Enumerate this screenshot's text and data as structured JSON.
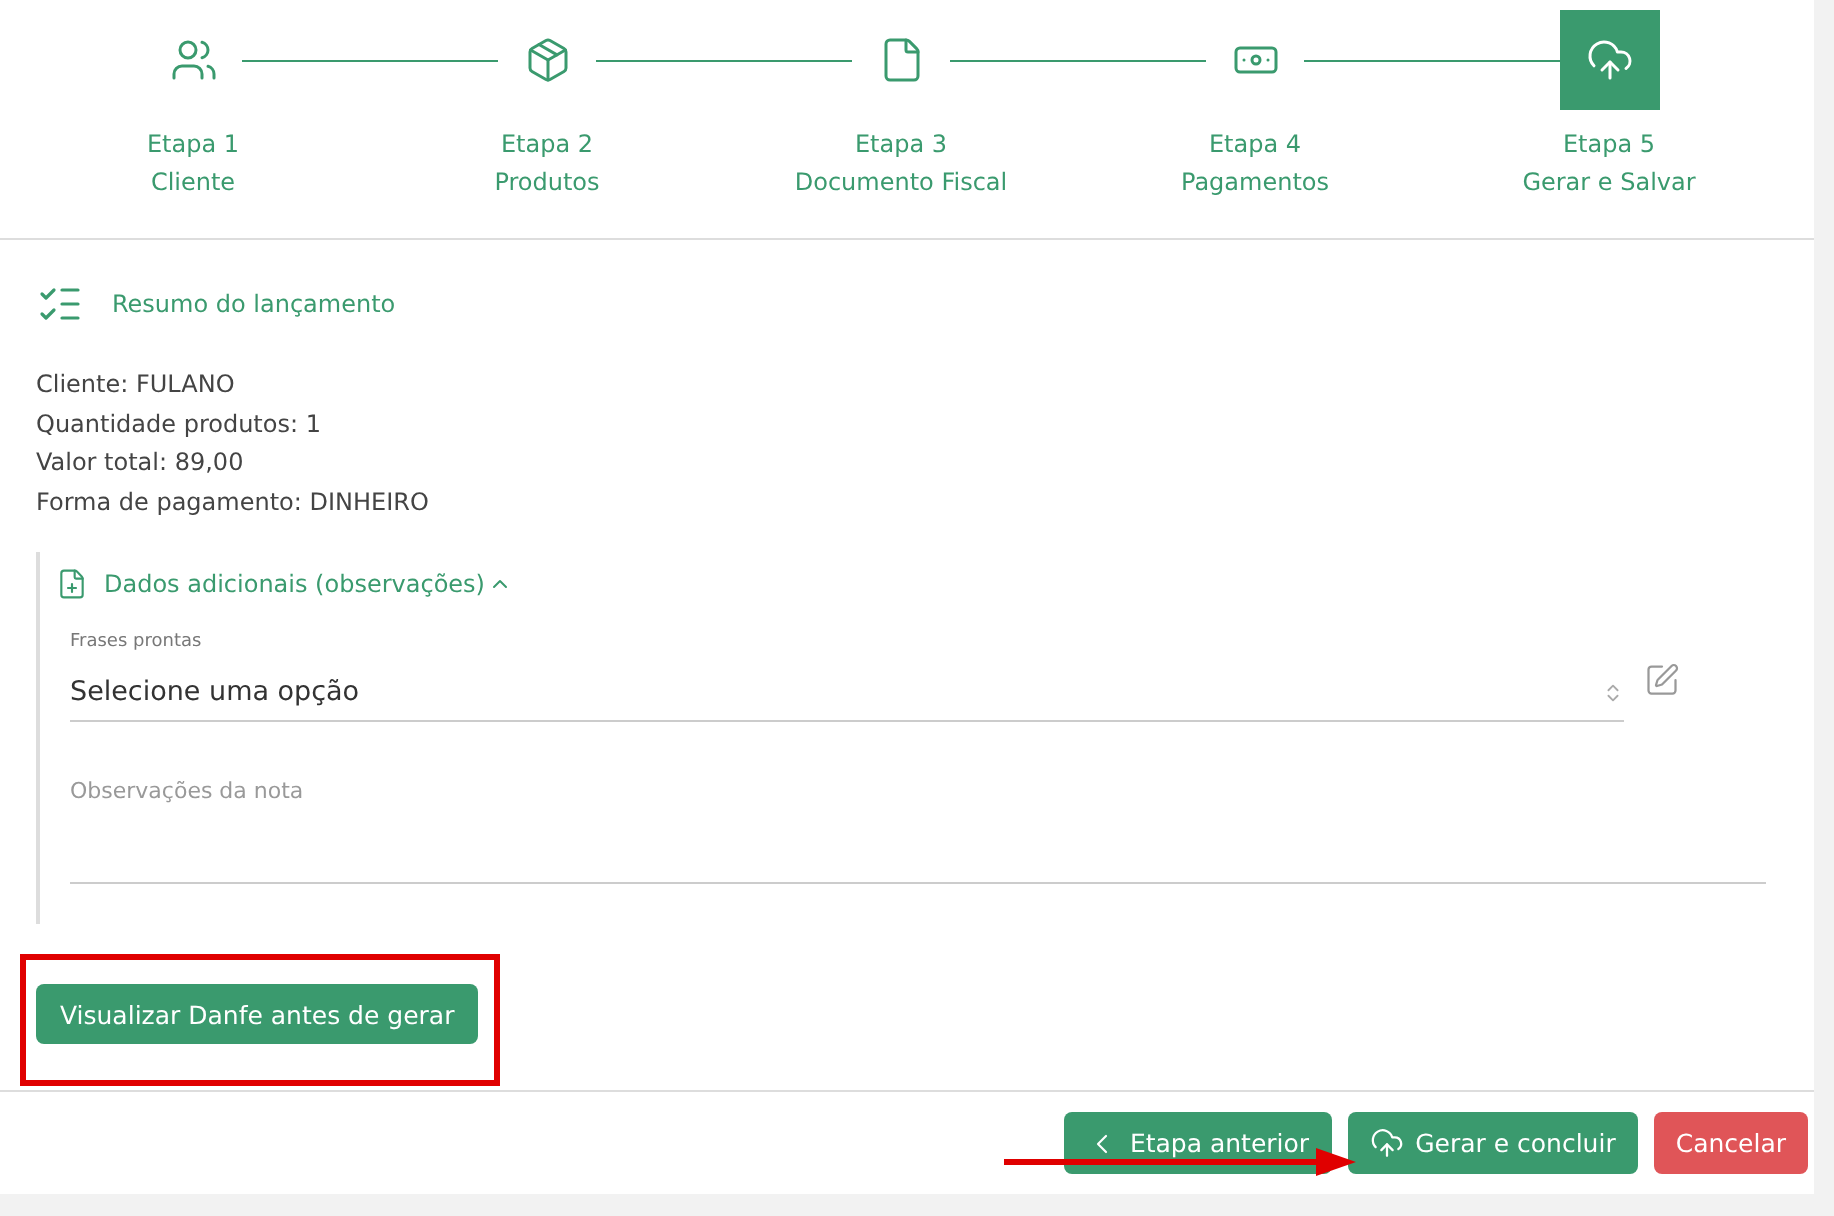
{
  "steps": [
    {
      "label": "Etapa 1",
      "name": "Cliente",
      "selected": false
    },
    {
      "label": "Etapa 2",
      "name": "Produtos",
      "selected": false
    },
    {
      "label": "Etapa 3",
      "name": "Documento Fiscal",
      "selected": false
    },
    {
      "label": "Etapa 4",
      "name": "Pagamentos",
      "selected": false
    },
    {
      "label": "Etapa 5",
      "name": "Gerar e Salvar",
      "selected": true
    }
  ],
  "summary": {
    "title": "Resumo do lançamento",
    "lines": [
      "Cliente: FULANO",
      "Quantidade produtos: 1",
      "Valor total: 89,00",
      "Forma de pagamento: DINHEIRO"
    ]
  },
  "additional": {
    "title": "Dados adicionais (observações)",
    "expanded": true,
    "phrases": {
      "label": "Frases prontas",
      "value": "Selecione uma opção"
    },
    "notes": {
      "placeholder": "Observações da nota"
    }
  },
  "preview_button": "Visualizar Danfe antes de gerar",
  "footer": [
    {
      "label": "Etapa anterior",
      "kind": "back"
    },
    {
      "label": "Gerar e concluir",
      "kind": "primary"
    },
    {
      "label": "Cancelar",
      "kind": "danger"
    }
  ]
}
